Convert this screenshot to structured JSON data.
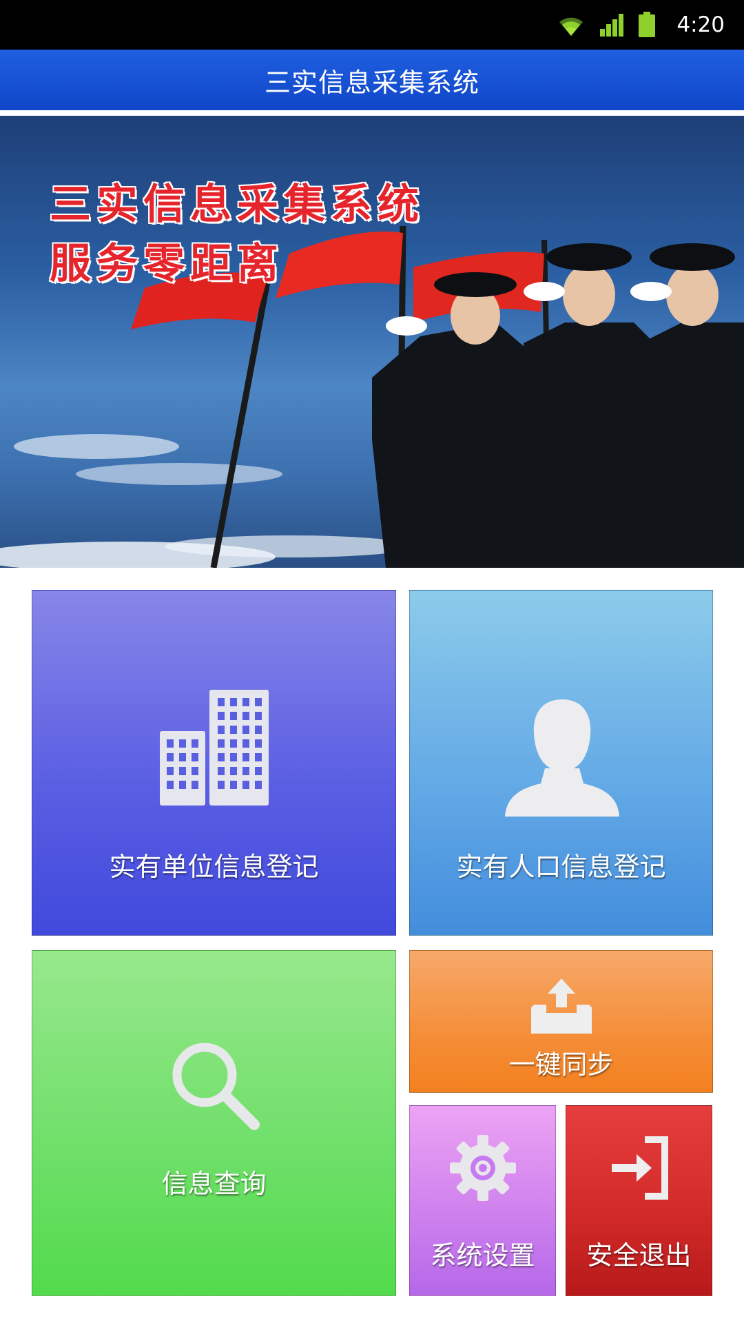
{
  "status_bar": {
    "time": "4:20",
    "icons": [
      "wifi-icon",
      "signal-icon",
      "battery-icon"
    ]
  },
  "app_bar": {
    "title": "三实信息采集系统"
  },
  "banner": {
    "headline": "三实信息采集系统",
    "slogan": "服务零距离"
  },
  "tiles": {
    "unit_register": {
      "label": "实有单位信息登记",
      "icon": "building-icon",
      "color": "#5a5fe0"
    },
    "population_register": {
      "label": "实有人口信息登记",
      "icon": "person-icon",
      "color": "#62a9e4"
    },
    "info_query": {
      "label": "信息查询",
      "icon": "search-icon",
      "color": "#6fe06b"
    },
    "one_key_sync": {
      "label": "一键同步",
      "icon": "upload-tray-icon",
      "color": "#f58a2e"
    },
    "system_settings": {
      "label": "系统设置",
      "icon": "gear-icon",
      "color": "#c57af0"
    },
    "safe_exit": {
      "label": "安全退出",
      "icon": "exit-icon",
      "color": "#d42b2b"
    }
  }
}
